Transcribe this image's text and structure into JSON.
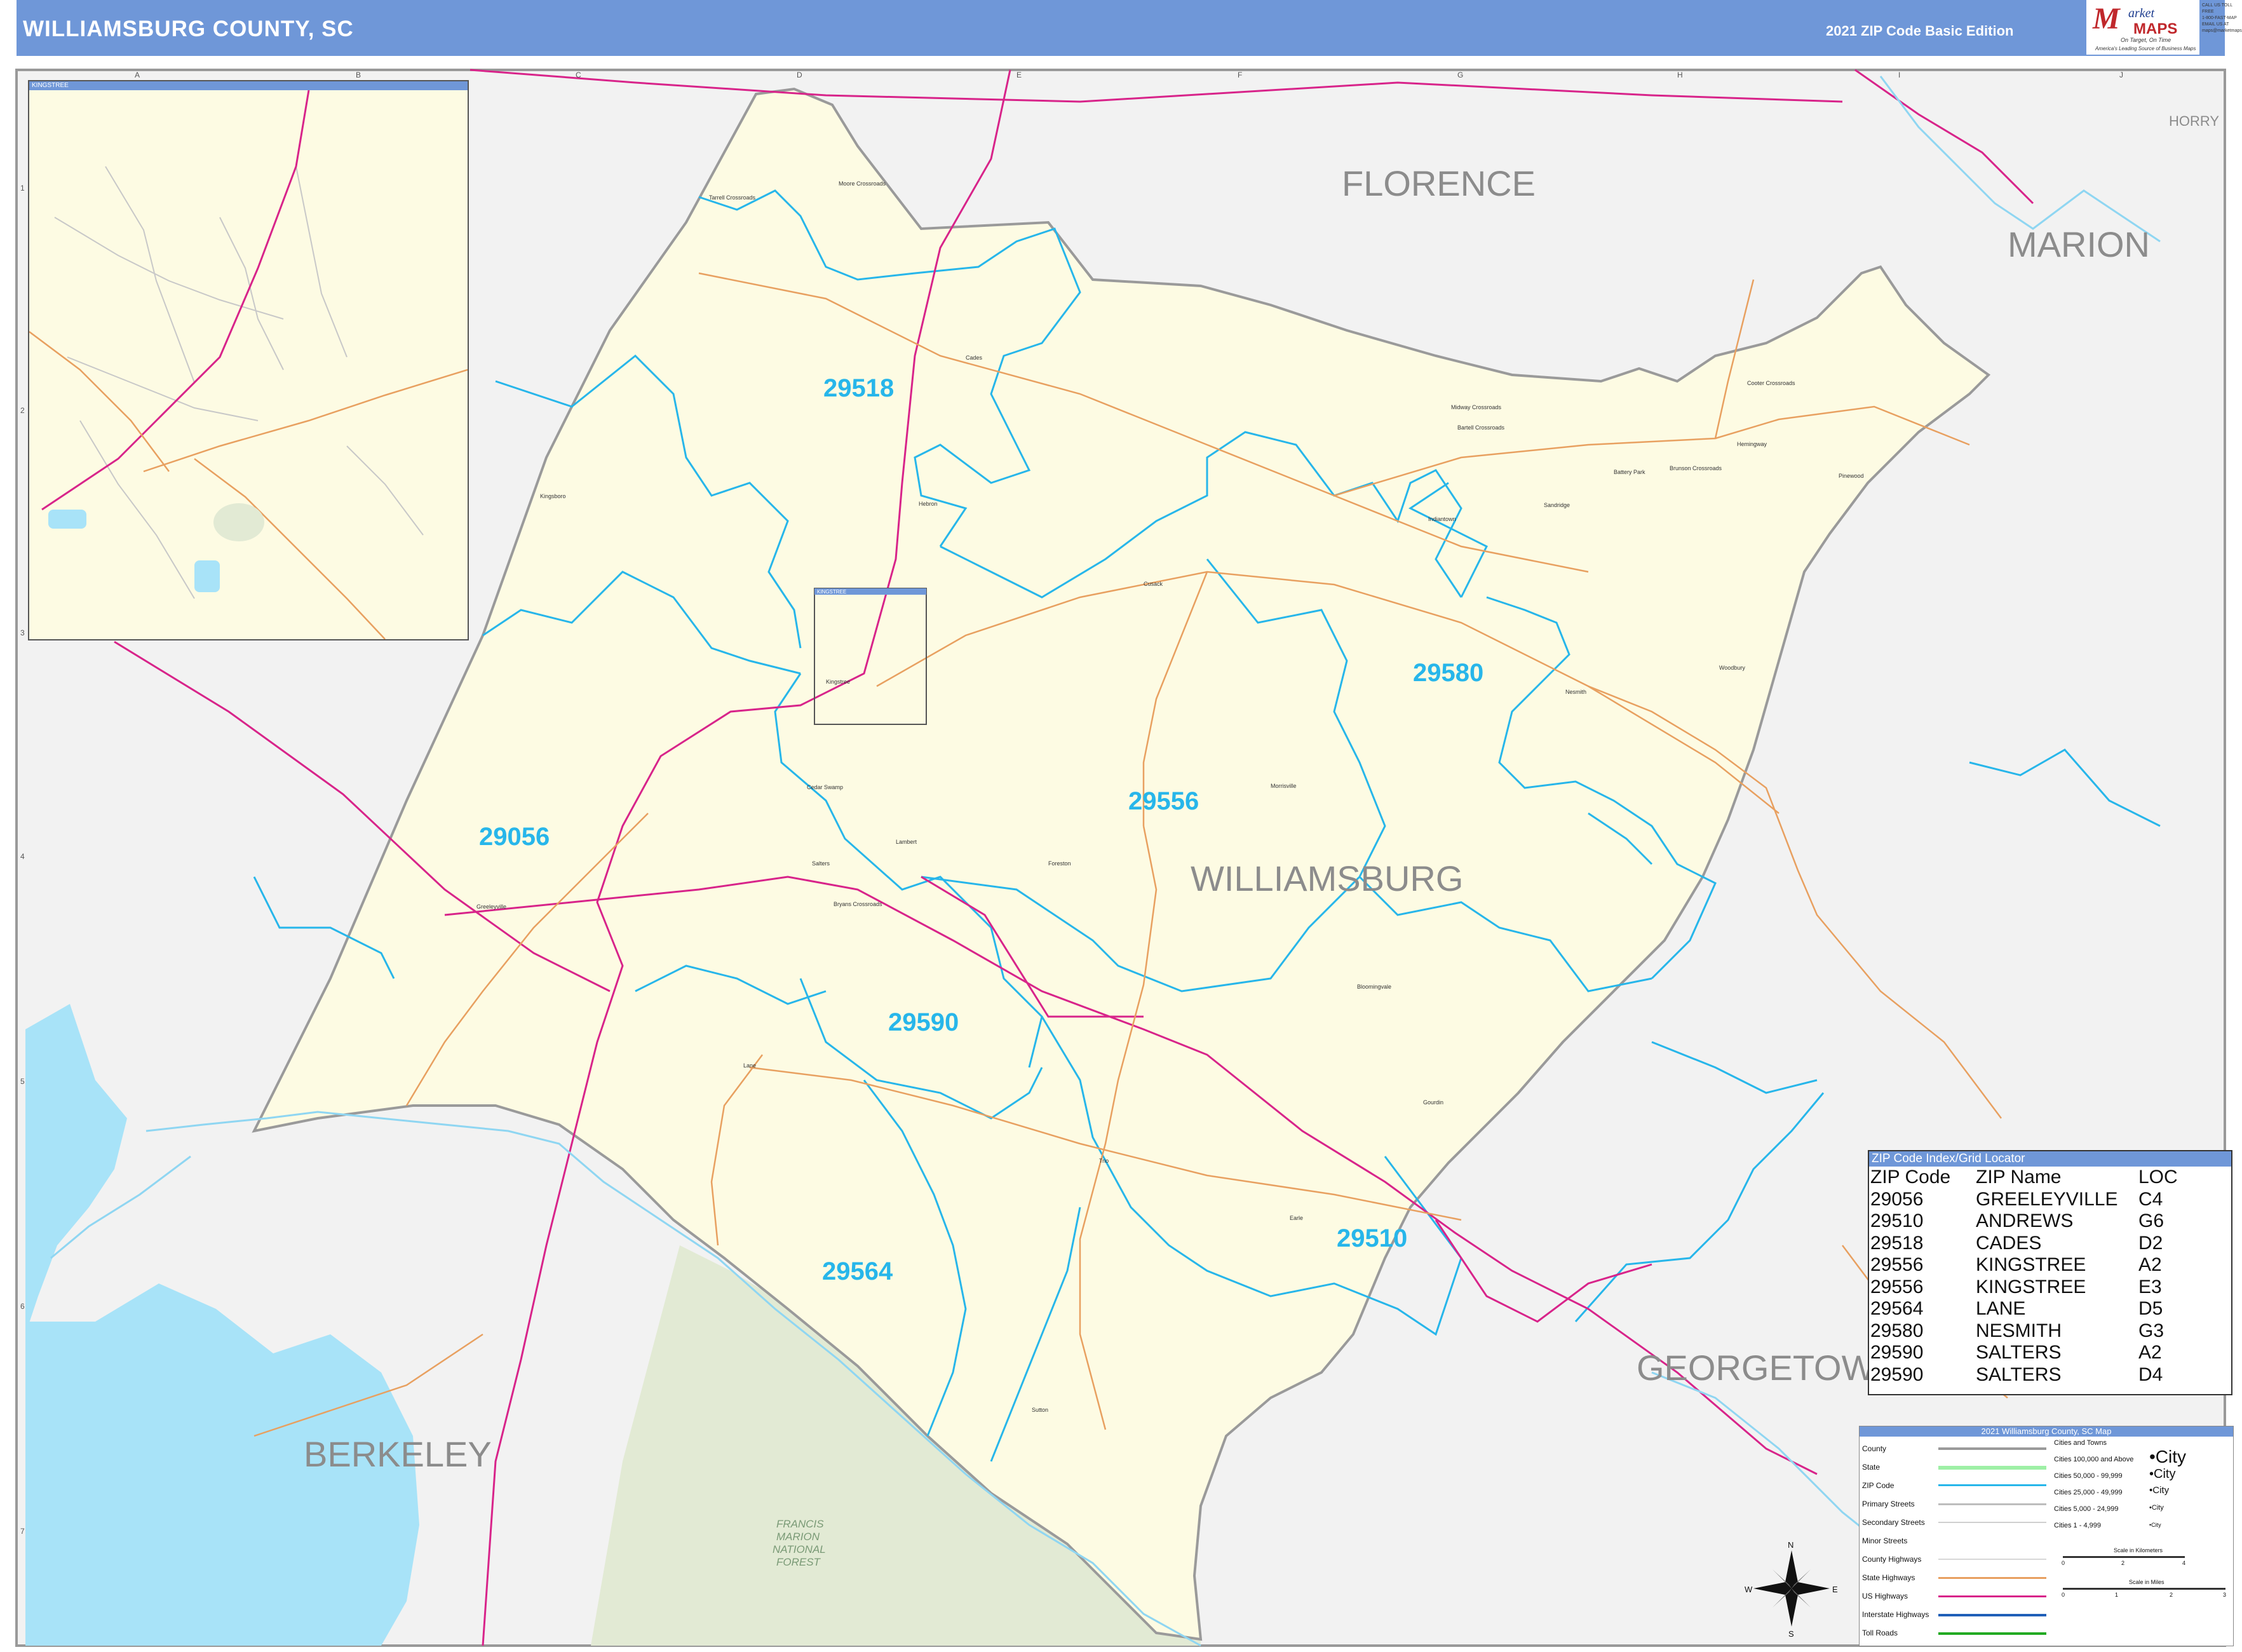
{
  "header": {
    "title": "WILLIAMSBURG COUNTY, SC",
    "edition": "2021 ZIP Code Basic Edition"
  },
  "logo": {
    "mark": "M",
    "line1": "arket",
    "line2": "MAPS",
    "tagline": "On Target, On Time",
    "sub": "America's Leading Source of Business Maps"
  },
  "contact": [
    "CALL US TOLL FREE",
    "1-800-FAST-MAP",
    "EMAIL US AT",
    "maps@marketmaps.com"
  ],
  "grid": {
    "cols": [
      "A",
      "B",
      "C",
      "D",
      "E",
      "F",
      "G",
      "H",
      "I",
      "J"
    ],
    "rows": [
      "1",
      "2",
      "3",
      "4",
      "5",
      "6",
      "7"
    ]
  },
  "counties": [
    {
      "id": "florence",
      "name": "FLORENCE"
    },
    {
      "id": "marion",
      "name": "MARION"
    },
    {
      "id": "horry",
      "name": "HORRY"
    },
    {
      "id": "williamsburg",
      "name": "WILLIAMSBURG"
    },
    {
      "id": "georgetown",
      "name": "GEORGETOWN"
    },
    {
      "id": "berkeley",
      "name": "BERKELEY"
    }
  ],
  "forest": {
    "line1": "FRANCIS",
    "line2": "MARION",
    "line3": "NATIONAL",
    "line4": "FOREST"
  },
  "zip_labels": [
    {
      "code": "29518"
    },
    {
      "code": "29580"
    },
    {
      "code": "29556"
    },
    {
      "code": "29056"
    },
    {
      "code": "29590"
    },
    {
      "code": "29510"
    },
    {
      "code": "29564"
    }
  ],
  "towns": [
    "Tarrell Crossroads",
    "Moore Crossroads",
    "Cades",
    "Hebron",
    "Kingstree",
    "Cedar Swamp",
    "Greeleyville",
    "Salters",
    "Bryans Crossroads",
    "Lane",
    "Trio",
    "Hemingway",
    "Nesmith",
    "Indiantown",
    "Midway Crossroads",
    "Bartell Crossroads",
    "Bloomingvale",
    "Sutton",
    "Morrisville",
    "Lambert",
    "Foreston",
    "Cusack",
    "Gourdin",
    "Kingsboro",
    "Battery Park",
    "Pinewood",
    "Brunson Crossroads",
    "Cooter Crossroads",
    "Earle",
    "Sandridge",
    "Woodbury"
  ],
  "inset": {
    "title": "KINGSTREE",
    "locator_title": "KINGSTREE"
  },
  "zip_index": {
    "title": "ZIP Code Index/Grid Locator",
    "headers": [
      "ZIP Code",
      "ZIP Name",
      "LOC"
    ],
    "rows": [
      [
        "29056",
        "GREELEYVILLE",
        "C4"
      ],
      [
        "29510",
        "ANDREWS",
        "G6"
      ],
      [
        "29518",
        "CADES",
        "D2"
      ],
      [
        "29556",
        "KINGSTREE",
        "A2"
      ],
      [
        "29556",
        "KINGSTREE",
        "E3"
      ],
      [
        "29564",
        "LANE",
        "D5"
      ],
      [
        "29580",
        "NESMITH",
        "G3"
      ],
      [
        "29590",
        "SALTERS",
        "A2"
      ],
      [
        "29590",
        "SALTERS",
        "D4"
      ]
    ]
  },
  "legend": {
    "title": "2021 Williamsburg County, SC Map",
    "items": [
      "County",
      "State",
      "ZIP Code",
      "Primary Streets",
      "Secondary Streets",
      "Minor Streets",
      "County Highways",
      "State Highways",
      "US Highways",
      "Interstate Highways",
      "Toll Roads"
    ],
    "cities_title": "Cities and Towns",
    "cities": [
      {
        "range": "Cities 100,000 and Above",
        "sample": "•City"
      },
      {
        "range": "Cities 50,000 - 99,999",
        "sample": "•City"
      },
      {
        "range": "Cities 25,000 - 49,999",
        "sample": "•City"
      },
      {
        "range": "Cities 5,000 - 24,999",
        "sample": "•City"
      },
      {
        "range": "Cities 1 - 4,999",
        "sample": "•City"
      }
    ],
    "scale_km_label": "Scale in Kilometers",
    "scale_mi_label": "Scale in Miles",
    "km_ticks": [
      "0",
      "2",
      "4"
    ],
    "mi_ticks": [
      "0",
      "1",
      "2",
      "3"
    ]
  },
  "compass": {
    "n": "N",
    "s": "S",
    "e": "E",
    "w": "W"
  },
  "colors": {
    "header": "#6f97d8",
    "county_fill": "#fdfbe3",
    "zip_boundary": "#27b6ea",
    "water": "#a8e3f8",
    "forest": "#e2ead4",
    "us_highway": "#d8248a",
    "state_highway": "#e8a060"
  }
}
